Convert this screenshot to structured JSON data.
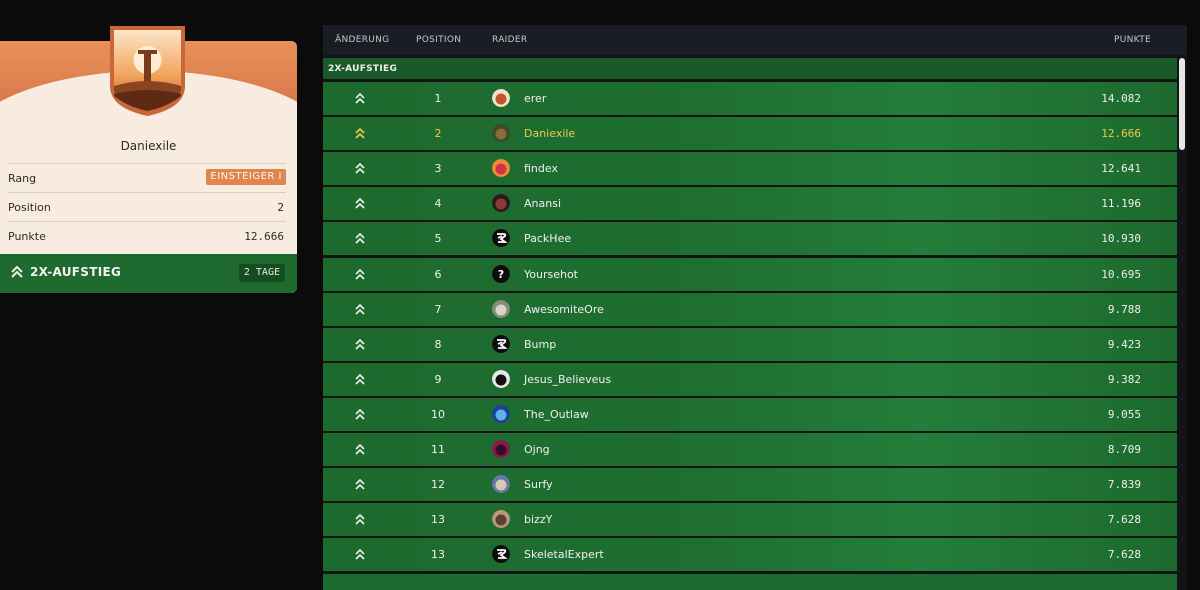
{
  "profile": {
    "name": "Daniexile",
    "stats": {
      "rank_label": "Rang",
      "rank_value": "EINSTEIGER I",
      "position_label": "Position",
      "position_value": "2",
      "points_label": "Punkte",
      "points_value": "12.666"
    },
    "promotion": {
      "label": "2X-AUFSTIEG",
      "days": "2 TAGE"
    }
  },
  "leaderboard": {
    "columns": {
      "change": "ÄNDERUNG",
      "position": "POSITION",
      "raider": "RAIDER",
      "points": "PUNKTE"
    },
    "section_title": "2X-AUFSTIEG",
    "rows": [
      {
        "position": "1",
        "name": "erer",
        "points": "14.082",
        "avatar": "fox-avatar"
      },
      {
        "position": "2",
        "name": "Daniexile",
        "points": "12.666",
        "avatar": "orc-avatar",
        "highlight": true
      },
      {
        "position": "3",
        "name": "findex",
        "points": "12.641",
        "avatar": "sunset-avatar"
      },
      {
        "position": "4",
        "name": "Anansi",
        "points": "11.196",
        "avatar": "spider-avatar"
      },
      {
        "position": "5",
        "name": "PackHee",
        "points": "10.930",
        "avatar": "default-logo-avatar"
      },
      {
        "position": "6",
        "name": "Yoursehot",
        "points": "10.695",
        "avatar": "question-avatar"
      },
      {
        "position": "7",
        "name": "AwesomiteOre",
        "points": "9.788",
        "avatar": "rock-avatar"
      },
      {
        "position": "8",
        "name": "Bump",
        "points": "9.423",
        "avatar": "default-logo-avatar"
      },
      {
        "position": "9",
        "name": "Jesus_Believeus",
        "points": "9.382",
        "avatar": "pirate-avatar"
      },
      {
        "position": "10",
        "name": "The_Outlaw",
        "points": "9.055",
        "avatar": "blue-avatar"
      },
      {
        "position": "11",
        "name": "Ojng",
        "points": "8.709",
        "avatar": "monster-avatar"
      },
      {
        "position": "12",
        "name": "Surfy",
        "points": "7.839",
        "avatar": "person-avatar"
      },
      {
        "position": "13",
        "name": "bizzY",
        "points": "7.628",
        "avatar": "face-avatar"
      },
      {
        "position": "13",
        "name": "SkeletalExpert",
        "points": "7.628",
        "avatar": "default-logo-avatar"
      }
    ]
  },
  "colors": {
    "accent_orange": "#e0854f",
    "row_green": "#1d6a2e",
    "highlight_yellow": "#f2c94c"
  }
}
